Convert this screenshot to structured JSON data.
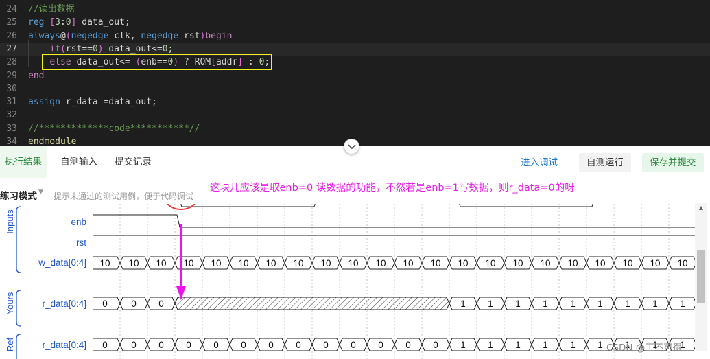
{
  "editor": {
    "lines": [
      {
        "num": "24",
        "current": false,
        "tokens": [
          {
            "t": "//读出数据",
            "c": "tok-comment"
          }
        ]
      },
      {
        "num": "25",
        "current": false,
        "tokens": [
          {
            "t": "reg ",
            "c": "tok-kw"
          },
          {
            "t": "[",
            "c": "tok-bracket"
          },
          {
            "t": "3",
            "c": "tok-num"
          },
          {
            "t": ":",
            "c": "tok-plain"
          },
          {
            "t": "0",
            "c": "tok-num"
          },
          {
            "t": "]",
            "c": "tok-bracket"
          },
          {
            "t": " data_out;",
            "c": "tok-plain"
          }
        ]
      },
      {
        "num": "26",
        "current": false,
        "tokens": [
          {
            "t": "always",
            "c": "tok-kw"
          },
          {
            "t": "@",
            "c": "tok-plain"
          },
          {
            "t": "(",
            "c": "tok-bracket"
          },
          {
            "t": "negedge",
            "c": "tok-kw"
          },
          {
            "t": " clk, ",
            "c": "tok-plain"
          },
          {
            "t": "negedge",
            "c": "tok-kw"
          },
          {
            "t": " rst",
            "c": "tok-plain"
          },
          {
            "t": ")",
            "c": "tok-bracket"
          },
          {
            "t": "begin",
            "c": "tok-ctrl"
          }
        ]
      },
      {
        "num": "27",
        "current": true,
        "tokens": [
          {
            "t": "    ",
            "c": "tok-plain"
          },
          {
            "t": "if",
            "c": "tok-ctrl"
          },
          {
            "t": "(",
            "c": "tok-bracket"
          },
          {
            "t": "rst==",
            "c": "tok-plain"
          },
          {
            "t": "0",
            "c": "tok-num"
          },
          {
            "t": ")",
            "c": "tok-bracket"
          },
          {
            "t": " data_out<=",
            "c": "tok-plain"
          },
          {
            "t": "0",
            "c": "tok-num"
          },
          {
            "t": ";",
            "c": "tok-plain"
          }
        ]
      },
      {
        "num": "28",
        "current": false,
        "tokens": [
          {
            "t": "    ",
            "c": "tok-plain"
          },
          {
            "t": "else",
            "c": "tok-ctrl"
          },
          {
            "t": " data_out<= ",
            "c": "tok-plain"
          },
          {
            "t": "(",
            "c": "tok-bracket"
          },
          {
            "t": "enb==",
            "c": "tok-plain"
          },
          {
            "t": "0",
            "c": "tok-num"
          },
          {
            "t": ")",
            "c": "tok-bracket"
          },
          {
            "t": " ? ROM",
            "c": "tok-plain"
          },
          {
            "t": "[",
            "c": "tok-bracket"
          },
          {
            "t": "addr",
            "c": "tok-plain"
          },
          {
            "t": "]",
            "c": "tok-bracket"
          },
          {
            "t": " : ",
            "c": "tok-plain"
          },
          {
            "t": "0",
            "c": "tok-num"
          },
          {
            "t": ";",
            "c": "tok-plain"
          }
        ]
      },
      {
        "num": "29",
        "current": false,
        "tokens": [
          {
            "t": "end",
            "c": "tok-ctrl"
          }
        ]
      },
      {
        "num": "30",
        "current": false,
        "tokens": []
      },
      {
        "num": "31",
        "current": false,
        "tokens": [
          {
            "t": "assign",
            "c": "tok-kw"
          },
          {
            "t": " r_data =data_out;",
            "c": "tok-plain"
          }
        ]
      },
      {
        "num": "32",
        "current": false,
        "tokens": []
      },
      {
        "num": "33",
        "current": false,
        "tokens": [
          {
            "t": "//*************code***********//",
            "c": "tok-comment"
          }
        ]
      },
      {
        "num": "34",
        "current": false,
        "tokens": [
          {
            "t": "endmodule",
            "c": "tok-yellow"
          }
        ]
      }
    ]
  },
  "tabs": [
    {
      "label": "执行结果",
      "active": true
    },
    {
      "label": "自测输入",
      "active": false
    },
    {
      "label": "提交记录",
      "active": false
    }
  ],
  "actions": {
    "debug": "进入调试",
    "self_run": "自测运行",
    "save_submit": "保存并提交"
  },
  "wave_panel": {
    "mode": "练习模式",
    "hint": "提示未通过的测试用例，便于代码调试",
    "note": "这块儿应该是取enb=0 读数据的功能，不然若是enb=1写数据，则r_data=0的呀",
    "groups": {
      "inputs": "Inputs",
      "yours": "Yours",
      "ref": "Ref"
    },
    "signals": {
      "enb": "enb",
      "rst": "rst",
      "w_data": "w_data[0:4]",
      "r_data_yours": "r_data[0:4]",
      "r_data_ref": "r_data[0:4]"
    },
    "w_data_values": [
      "10",
      "10",
      "10",
      "10",
      "10",
      "10",
      "10",
      "10",
      "10",
      "10",
      "10",
      "10",
      "10",
      "10",
      "10",
      "10",
      "10",
      "10",
      "10",
      "10",
      "10",
      "10",
      "10"
    ],
    "yours_values": {
      "before": [
        "0",
        "0",
        "0"
      ],
      "unknown_cycles": 10,
      "after": [
        "1",
        "1",
        "1",
        "1",
        "1",
        "1",
        "1",
        "1",
        "1",
        "1"
      ]
    },
    "ref_values": [
      "0",
      "0",
      "0",
      "0",
      "0",
      "0",
      "0",
      "0",
      "0",
      "0",
      "0",
      "0",
      "0",
      "1",
      "1",
      "1",
      "1",
      "1",
      "1",
      "1",
      "1",
      "1",
      "1"
    ]
  },
  "watermark": "CSDN @丁不可得",
  "colors": {
    "annotation": "#e81ee8",
    "highlight": "#f5ee1f",
    "circle": "#e53935",
    "accent_green": "#2b8a3e",
    "link_blue": "#1677c9"
  }
}
